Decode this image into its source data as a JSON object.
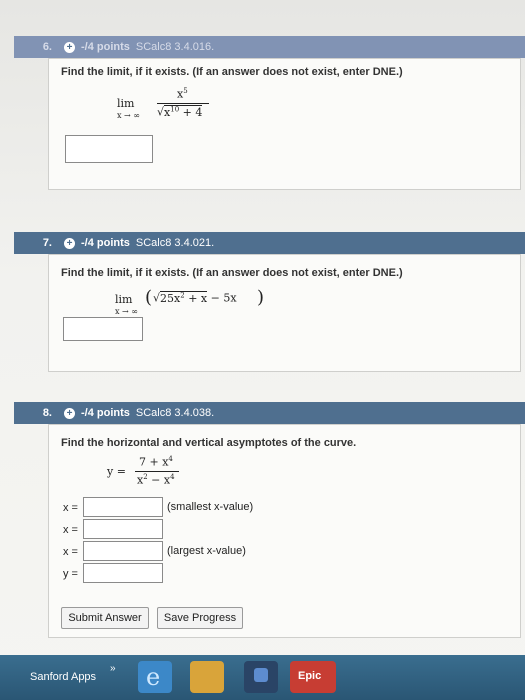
{
  "q6": {
    "number": "6.",
    "points": "-/4 points",
    "code": "SCalc8 3.4.016.",
    "prompt": "Find the limit, if it exists. (If an answer does not exist, enter DNE.)",
    "lim": "lim",
    "lim_sub": "x → ∞",
    "numerator": "x",
    "numerator_exp": "5",
    "radicand": "x",
    "radicand_exp": "10",
    "radicand_rest": "+ 4"
  },
  "q7": {
    "number": "7.",
    "points": "-/4 points",
    "code": "SCalc8 3.4.021.",
    "prompt": "Find the limit, if it exists. (If an answer does not exist, enter DNE.)",
    "lim": "lim",
    "lim_sub": "x → ∞",
    "expr_a": "25x",
    "expr_a_exp": "2",
    "expr_b": "+ x",
    "expr_c": "− 5x"
  },
  "q8": {
    "number": "8.",
    "points": "-/4 points",
    "code": "SCalc8 3.4.038.",
    "prompt": "Find the horizontal and vertical asymptotes of the curve.",
    "y_eq": "y =",
    "num": "7 + x",
    "num_exp": "4",
    "den_a": "x",
    "den_a_exp": "2",
    "den_b": " − x",
    "den_b_exp": "4",
    "rows": [
      {
        "label": "x =",
        "note": "(smallest x-value)"
      },
      {
        "label": "x =",
        "note": ""
      },
      {
        "label": "x =",
        "note": "(largest x-value)"
      },
      {
        "label": "y =",
        "note": ""
      }
    ],
    "submit_label": "Submit Answer",
    "save_label": "Save Progress"
  },
  "taskbar": {
    "sanford_label": "Sanford Apps",
    "chevron": "»",
    "epic_label": "Epic"
  }
}
